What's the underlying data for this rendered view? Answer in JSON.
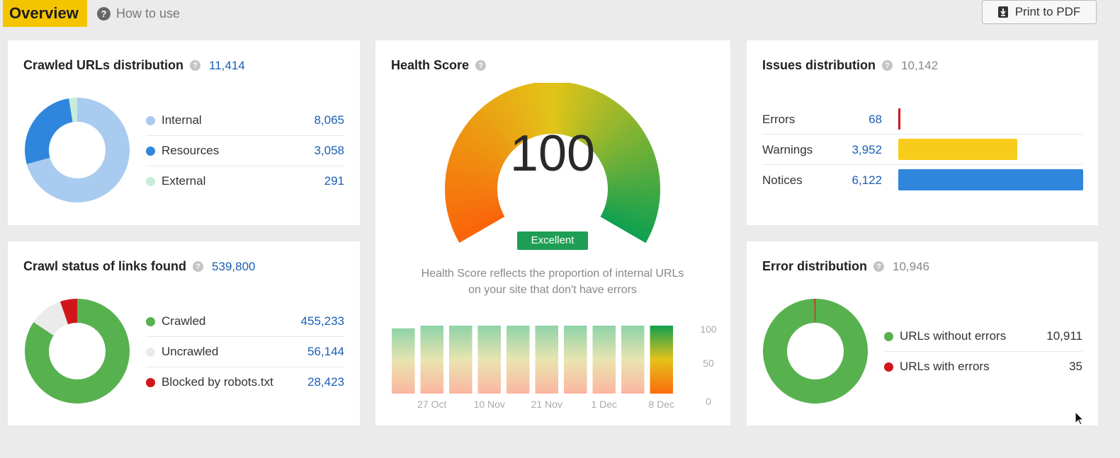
{
  "header": {
    "overview_label": "Overview",
    "howto_label": "How to use",
    "pdf_label": "Print to PDF"
  },
  "crawled_urls": {
    "title": "Crawled URLs distribution",
    "total": "11,414",
    "items": [
      {
        "label": "Internal",
        "value": "8,065",
        "color": "#a9cbef"
      },
      {
        "label": "Resources",
        "value": "3,058",
        "color": "#2f86dc"
      },
      {
        "label": "External",
        "value": "291",
        "color": "#c8ecd9"
      }
    ]
  },
  "crawl_status": {
    "title": "Crawl status of links found",
    "total": "539,800",
    "items": [
      {
        "label": "Crawled",
        "value": "455,233",
        "color": "#57b14f"
      },
      {
        "label": "Uncrawled",
        "value": "56,144",
        "color": "#ebebeb"
      },
      {
        "label": "Blocked by robots.txt",
        "value": "28,423",
        "color": "#d0161b"
      }
    ]
  },
  "health_score": {
    "title": "Health Score",
    "score": "100",
    "status": "Excellent",
    "description_line1": "Health Score reflects the proportion of internal URLs",
    "description_line2": "on your site that don't have errors"
  },
  "issues": {
    "title": "Issues distribution",
    "total": "10,142",
    "items": [
      {
        "label": "Errors",
        "value": "68",
        "color": "#d0161b"
      },
      {
        "label": "Warnings",
        "value": "3,952",
        "color": "#f8cc1b"
      },
      {
        "label": "Notices",
        "value": "6,122",
        "color": "#2f86dc"
      }
    ]
  },
  "errors": {
    "title": "Error distribution",
    "total": "10,946",
    "items": [
      {
        "label": "URLs without errors",
        "value": "10,911",
        "color": "#57b14f"
      },
      {
        "label": "URLs with errors",
        "value": "35",
        "color": "#d0161b"
      }
    ]
  },
  "chart_data": {
    "type": "bar",
    "categories": [
      "",
      "27 Oct",
      "",
      "10 Nov",
      "",
      "21 Nov",
      "",
      "1 Dec",
      "",
      "8 Dec"
    ],
    "x_tick_labels": [
      "27 Oct",
      "10 Nov",
      "21 Nov",
      "1 Dec",
      "8 Dec"
    ],
    "values": [
      96,
      100,
      100,
      100,
      100,
      100,
      100,
      100,
      100,
      100
    ],
    "ylim": [
      0,
      100
    ],
    "y_ticks": [
      0,
      50,
      100
    ],
    "highlight_last": true,
    "grid": false
  }
}
